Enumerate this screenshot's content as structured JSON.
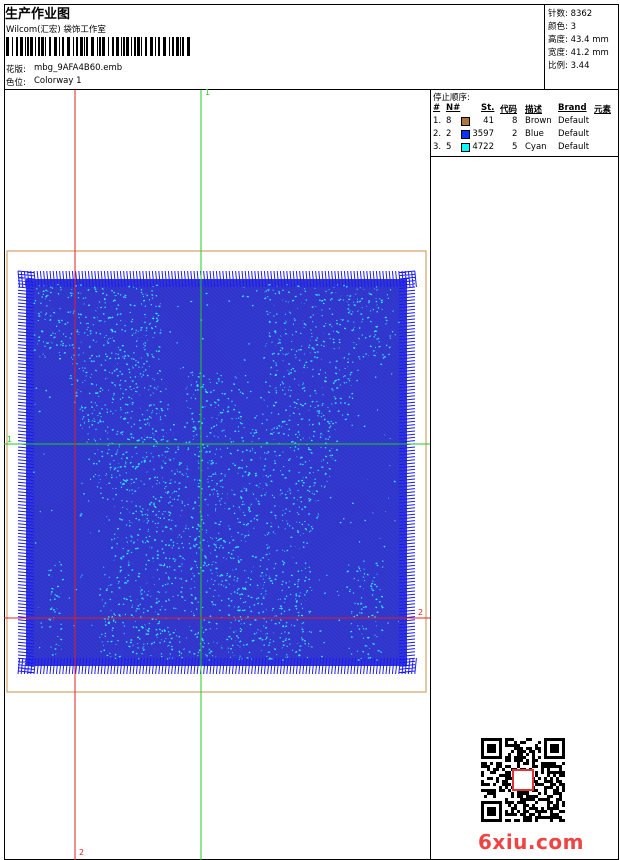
{
  "header": {
    "title": "生产作业图",
    "company": "Wilcom(汇宏) 袋饰工作室",
    "design_label": "花版:",
    "design_file": "mbg_9AFA4B60.emb",
    "colorway_label": "色位:",
    "colorway": "Colorway 1"
  },
  "stats": {
    "stitches": "针数: 8362",
    "colors": "颜色: 3",
    "height": "高度: 43.4 mm",
    "width": "宽度: 41.2 mm",
    "scale": "比例: 3.44"
  },
  "stop_sequence": {
    "title": "停止顺序:",
    "headers": [
      "#",
      "N#",
      "St.",
      "代码",
      "描述",
      "Brand",
      "元素"
    ],
    "rows": [
      {
        "idx": "1.",
        "n": "8",
        "swatch": "#b0733a",
        "st": "41",
        "code": "8",
        "desc": "Brown",
        "brand": "Default"
      },
      {
        "idx": "2.",
        "n": "2",
        "swatch": "#0033ff",
        "st": "3597",
        "code": "2",
        "desc": "Blue",
        "brand": "Default"
      },
      {
        "idx": "3.",
        "n": "5",
        "swatch": "#00ffff",
        "st": "4722",
        "code": "5",
        "desc": "Cyan",
        "brand": "Default"
      }
    ]
  },
  "guides": {
    "green_v_label": "1",
    "green_h_label": "1",
    "red_h_label": "2",
    "red_v_label": "2"
  },
  "watermark": "6xiu.com",
  "colors": {
    "blue": "#1a1aff",
    "cyan": "#33e6ff",
    "brown_frame": "#c8914a",
    "guide_green": "#22cc22",
    "guide_red": "#e02020"
  }
}
